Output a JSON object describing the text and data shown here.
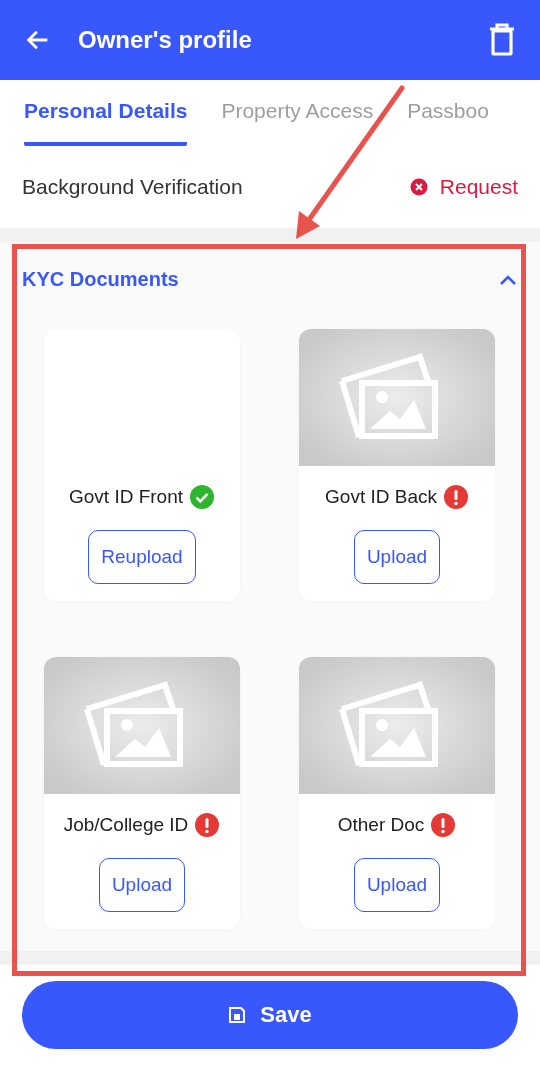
{
  "header": {
    "title": "Owner's profile"
  },
  "tabs": [
    {
      "label": "Personal Details",
      "selected": true
    },
    {
      "label": "Property Access",
      "selected": false
    },
    {
      "label": "Passboo",
      "selected": false
    }
  ],
  "verification": {
    "label": "Background Verification",
    "failed": true,
    "action": "Request"
  },
  "kyc": {
    "title": "KYC Documents",
    "expanded": true,
    "documents": [
      {
        "label": "Govt ID Front",
        "uploaded": true,
        "button": "Reupload"
      },
      {
        "label": "Govt ID Back",
        "uploaded": false,
        "button": "Upload"
      },
      {
        "label": "Job/College ID",
        "uploaded": false,
        "button": "Upload"
      },
      {
        "label": "Other Doc",
        "uploaded": false,
        "button": "Upload"
      }
    ]
  },
  "save_button": {
    "label": "Save"
  }
}
